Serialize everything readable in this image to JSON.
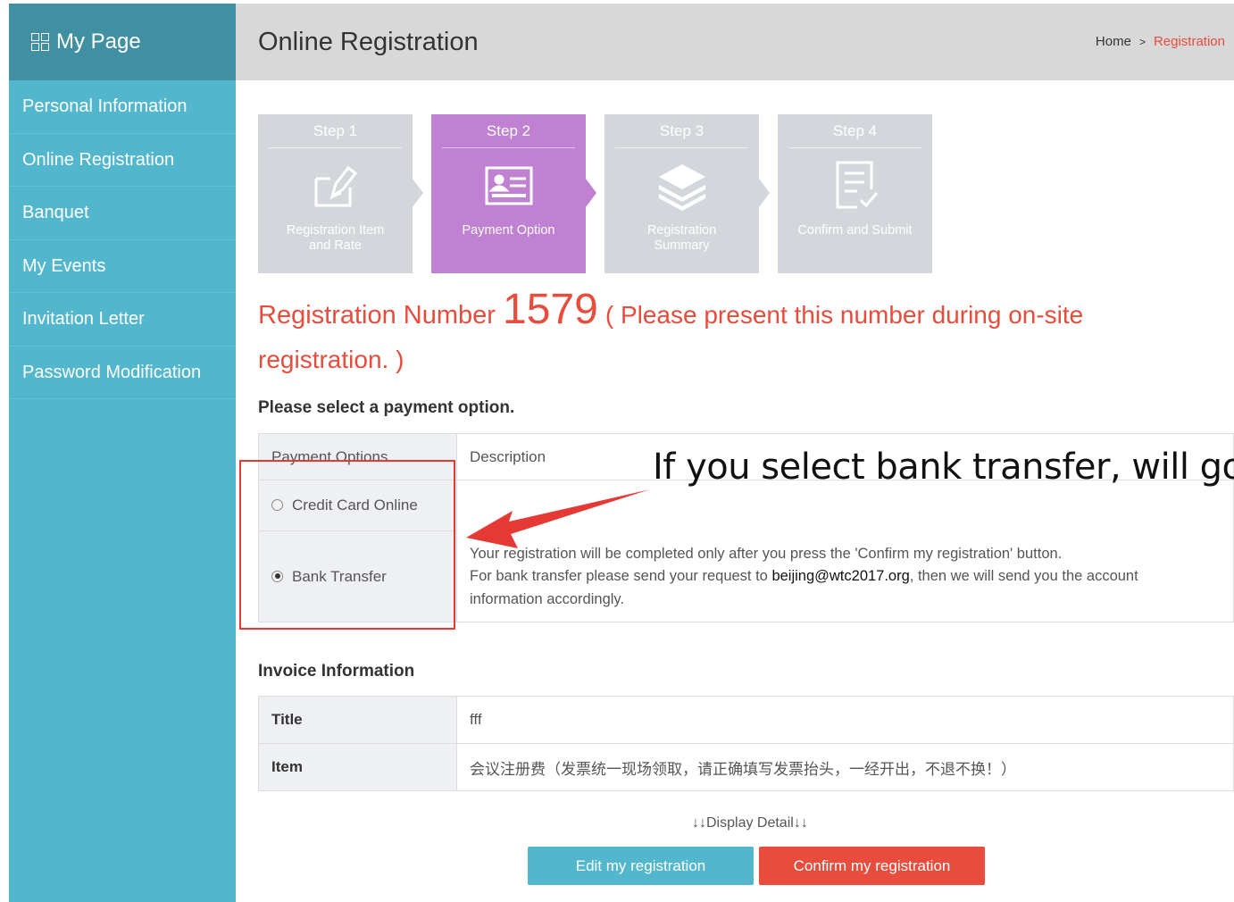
{
  "sidebar": {
    "title": "My Page",
    "items": [
      {
        "label": "Personal Information"
      },
      {
        "label": "Online Registration"
      },
      {
        "label": "Banquet"
      },
      {
        "label": "My Events"
      },
      {
        "label": "Invitation Letter"
      },
      {
        "label": "Password Modification"
      }
    ]
  },
  "header": {
    "title": "Online Registration",
    "breadcrumb": {
      "home": "Home",
      "separator": ">",
      "current": "Registration"
    }
  },
  "steps": [
    {
      "title": "Step 1",
      "label_line1": "Registration Item",
      "label_line2": "and Rate",
      "icon": "edit-doc-icon",
      "active": false
    },
    {
      "title": "Step 2",
      "label_line1": "Payment Option",
      "label_line2": "",
      "icon": "id-card-icon",
      "active": true
    },
    {
      "title": "Step 3",
      "label_line1": "Registration",
      "label_line2": "Summary",
      "icon": "layers-icon",
      "active": false
    },
    {
      "title": "Step 4",
      "label_line1": "Confirm and Submit",
      "label_line2": "",
      "icon": "checklist-icon",
      "active": false
    }
  ],
  "registration": {
    "prefix": "Registration Number",
    "number": "1579",
    "note": "( Please present this number during on-site registration. )"
  },
  "payment": {
    "section_title": "Please select a payment option.",
    "headers": {
      "options": "Payment Options",
      "description": "Description"
    },
    "options": [
      {
        "label": "Credit Card Online",
        "selected": false
      },
      {
        "label": "Bank Transfer",
        "selected": true
      }
    ],
    "description": {
      "line1": "Your registration will be completed only after you press the 'Confirm my registration' button.",
      "line2_before": "For bank transfer please send your request to ",
      "email": "beijing@wtc2017.org",
      "line2_after": ", then we will send you the account",
      "line3": "information accordingly."
    }
  },
  "invoice": {
    "section_title": "Invoice Information",
    "rows": [
      {
        "key": "Title",
        "value": "fff"
      },
      {
        "key": "Item",
        "value": "会议注册费（发票统一现场领取，请正确填写发票抬头，一经开出，不退不换！）"
      }
    ]
  },
  "display_detail": "↓↓Display Detail↓↓",
  "buttons": {
    "edit": "Edit my registration",
    "confirm": "Confirm my registration"
  },
  "annotation": {
    "text": "If you select bank transfer, will go"
  },
  "colors": {
    "sidebar": "#52b7cd",
    "sidebar_header": "#4190a1",
    "accent_red": "#e74c3c",
    "step_active": "#c081d3",
    "step_inactive": "#d3d7dc"
  }
}
